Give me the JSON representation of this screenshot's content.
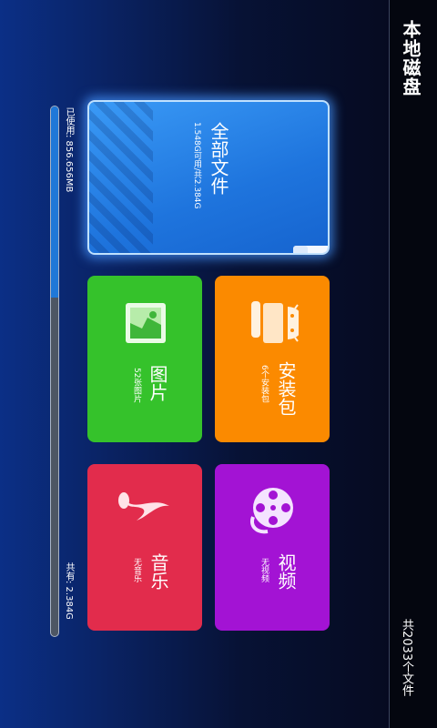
{
  "header": {
    "title": "本地磁盘",
    "total_files": "共2033个文件"
  },
  "storage": {
    "used_label": "已使用: 856.656MB",
    "total_label": "共有: 2.384G",
    "used_fraction": 0.36
  },
  "tiles": {
    "all": {
      "title": "全部文件",
      "sub": "1.548G可用/共2.384G",
      "icon": "folder-icon"
    },
    "pics": {
      "title": "图片",
      "sub": "52张图片",
      "icon": "image-icon"
    },
    "apk": {
      "title": "安装包",
      "sub": "6个安装包",
      "icon": "android-icon"
    },
    "music": {
      "title": "音乐",
      "sub": "无音乐",
      "icon": "music-note-icon"
    },
    "video": {
      "title": "视频",
      "sub": "无视频",
      "icon": "film-reel-icon"
    }
  },
  "colors": {
    "all": "#1e74dd",
    "pics": "#35c22b",
    "apk": "#fb8a00",
    "music": "#e22c4c",
    "video": "#a313d4"
  }
}
